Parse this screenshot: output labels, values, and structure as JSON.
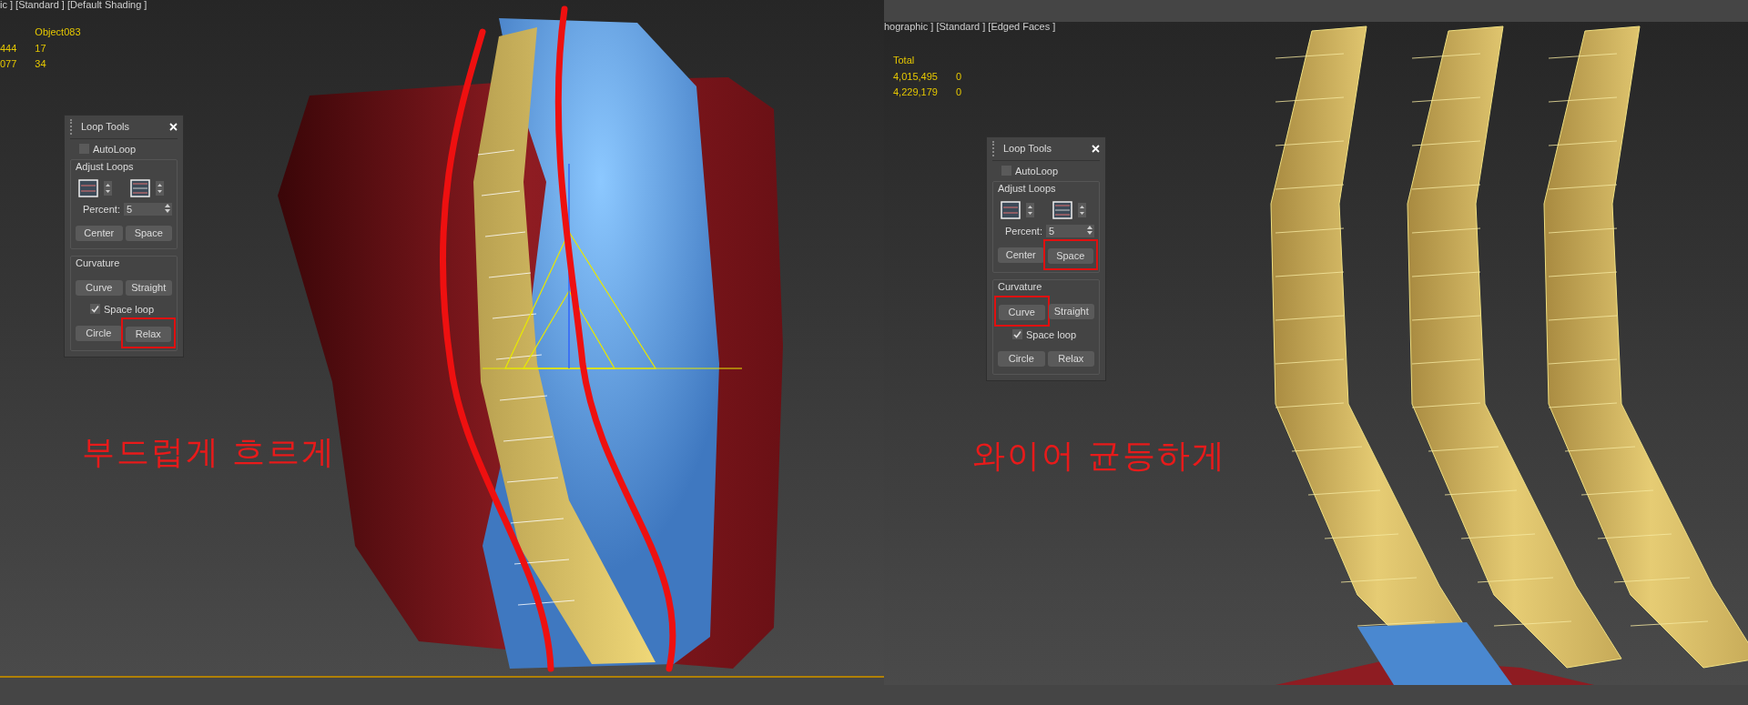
{
  "viewports": [
    {
      "label": "ic ] [Standard ] [Default Shading ]",
      "stats": [
        {
          "col_2": "Object083"
        },
        {
          "col_1": "444",
          "col_2": "17"
        },
        {
          "col_1": "077",
          "col_2": "34"
        }
      ],
      "annotation": "부드럽게 흐르게",
      "panel": {
        "title": "Loop Tools",
        "autoloop": {
          "label": "AutoLoop",
          "checked": false
        },
        "adjust_label": "Adjust Loops",
        "percent_label": "Percent:",
        "percent_value": "5",
        "adjust_buttons": [
          {
            "label": "Center",
            "highlighted": false
          },
          {
            "label": "Space",
            "highlighted": false
          }
        ],
        "curvature_label": "Curvature",
        "curve_buttons": [
          {
            "label": "Curve",
            "highlighted": false
          },
          {
            "label": "Straight",
            "highlighted": false
          }
        ],
        "space_loop": {
          "label": "Space loop",
          "checked": true
        },
        "shape_buttons": [
          {
            "label": "Circle",
            "highlighted": false
          },
          {
            "label": "Relax",
            "highlighted": true
          }
        ]
      }
    },
    {
      "label": "hographic ] [Standard ] [Edged Faces ]",
      "stats": [
        {
          "col_1": "Total"
        },
        {
          "col_1": "4,015,495",
          "col_2": "0"
        },
        {
          "col_1": "4,229,179",
          "col_2": "0"
        }
      ],
      "annotation": "와이어 균등하게",
      "panel": {
        "title": "Loop Tools",
        "autoloop": {
          "label": "AutoLoop",
          "checked": false
        },
        "adjust_label": "Adjust Loops",
        "percent_label": "Percent:",
        "percent_value": "5",
        "adjust_buttons": [
          {
            "label": "Center",
            "highlighted": false
          },
          {
            "label": "Space",
            "highlighted": true
          }
        ],
        "curvature_label": "Curvature",
        "curve_buttons": [
          {
            "label": "Curve",
            "highlighted": true
          },
          {
            "label": "Straight",
            "highlighted": false
          }
        ],
        "space_loop": {
          "label": "Space loop",
          "checked": true
        },
        "shape_buttons": [
          {
            "label": "Circle",
            "highlighted": false
          },
          {
            "label": "Relax",
            "highlighted": false
          }
        ]
      }
    }
  ]
}
